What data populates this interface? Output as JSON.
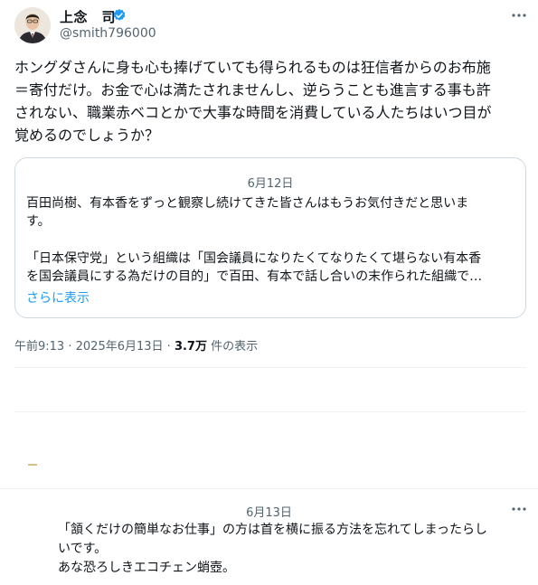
{
  "tweet": {
    "author_name": "上念　司",
    "handle": "@smith796000",
    "more_icon": "more-horizontal-icon",
    "verified_icon": "verified-badge-icon",
    "verified_color": "#1d9bf0",
    "body_lines": [
      "ホングダさんに身も心も捧げていても得られるものは狂信者からのお布施",
      "＝寄付だけ。お金で心は満たされませんし、逆らうことも進言する事も許",
      "されない、職業赤ベコとかで大事な時間を消費している人たちはいつ目が",
      "覚めるのでしょうか？"
    ]
  },
  "quote": {
    "date": "6月12日",
    "lines": [
      "百田尚樹、有本香をずっと観察し続けてきた皆さんはもうお気付きだと思いま",
      "す。",
      "「日本保守党」という組織は「国会議員になりたくてなりたくて堪らない有本香",
      "を国会議員にする為だけの目的」で百田、有本で話し合いの末作られた組織で…"
    ],
    "show_more": "さらに表示",
    "link_color": "#1d9bf0"
  },
  "meta": {
    "time": "午前9:13",
    "separator": "·",
    "date": "2025年6月13日",
    "views_count": "3.7万",
    "views_label": "件の表示"
  },
  "reply": {
    "date": "6月13日",
    "more_icon": "more-horizontal-icon",
    "lines": [
      "「頷くだけの簡単なお仕事」の方は首を横に振る方法を忘れてしまったらし",
      "いです。",
      "あな恐ろしきエコチェン蛸壺。"
    ]
  }
}
